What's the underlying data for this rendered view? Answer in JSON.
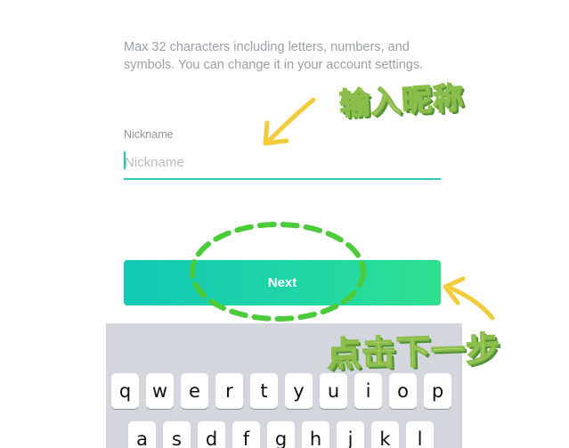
{
  "form": {
    "help_text": "Max 32 characters including letters, numbers, and symbols. You can change it in your account settings.",
    "nickname_label": "Nickname",
    "nickname_placeholder": "Nickname",
    "nickname_value": "",
    "next_label": "Next"
  },
  "annotations": {
    "enter_nickname": "输入昵称",
    "click_next": "点击下一步",
    "color_arrow": "#f2cc3c",
    "color_dashed_circle": "#4ccb3a"
  },
  "keyboard": {
    "row1": [
      "q",
      "w",
      "e",
      "r",
      "t",
      "y",
      "u",
      "i",
      "o",
      "p"
    ],
    "row2": [
      "a",
      "s",
      "d",
      "f",
      "g",
      "h",
      "j",
      "k",
      "l"
    ]
  },
  "colors": {
    "accent": "#2ec9b9",
    "button_gradient_start": "#12c8b6",
    "button_gradient_end": "#2ee08f",
    "keyboard_bg": "#d3d6dc"
  }
}
